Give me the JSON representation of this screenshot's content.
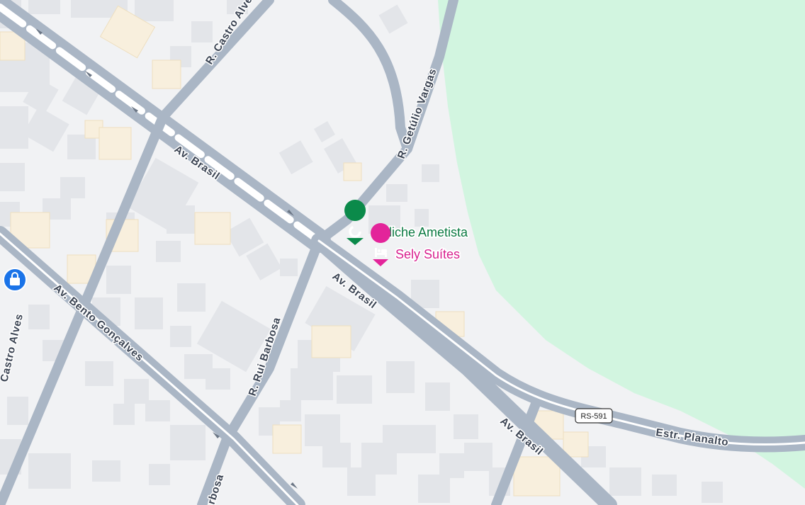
{
  "map": {
    "colors": {
      "land": "#f1f2f4",
      "park": "#d2f5e0",
      "road": "#aab6c5",
      "road_inner": "#ffffff",
      "building": "#e3e5e9",
      "building_warm": "#f8efdd",
      "poi_green": "#0b8a4a",
      "poi_pink": "#e3249a",
      "shop_blue": "#1a73e8"
    },
    "streets": {
      "av_brasil_upper": "Av. Brasil",
      "av_brasil_middle": "Av. Brasil",
      "av_brasil_lower": "Av. Brasil",
      "r_castro_alves_top": "R. Castro Alves",
      "r_castro_alves_left": "Castro Alves",
      "av_bento_goncalves": "Av. Bento Gonçalves",
      "r_rui_barbosa": "R. Rui Barbosa",
      "r_rui_barbosa_bottom": "rbosa",
      "r_getulio_vargas": "R. Getúlio Vargas",
      "estr_planalto": "Estr. Planalto"
    },
    "route_shield": "RS-591",
    "pois": [
      {
        "name": "Boliche Ametista",
        "icon": "bowling-icon",
        "color": "#0b8a4a"
      },
      {
        "name": "Sely Suítes",
        "icon": "hotel-bed-icon",
        "color": "#e3249a"
      }
    ],
    "shop_marker": {
      "icon": "shopping-bag-icon",
      "color": "#1a73e8"
    }
  }
}
